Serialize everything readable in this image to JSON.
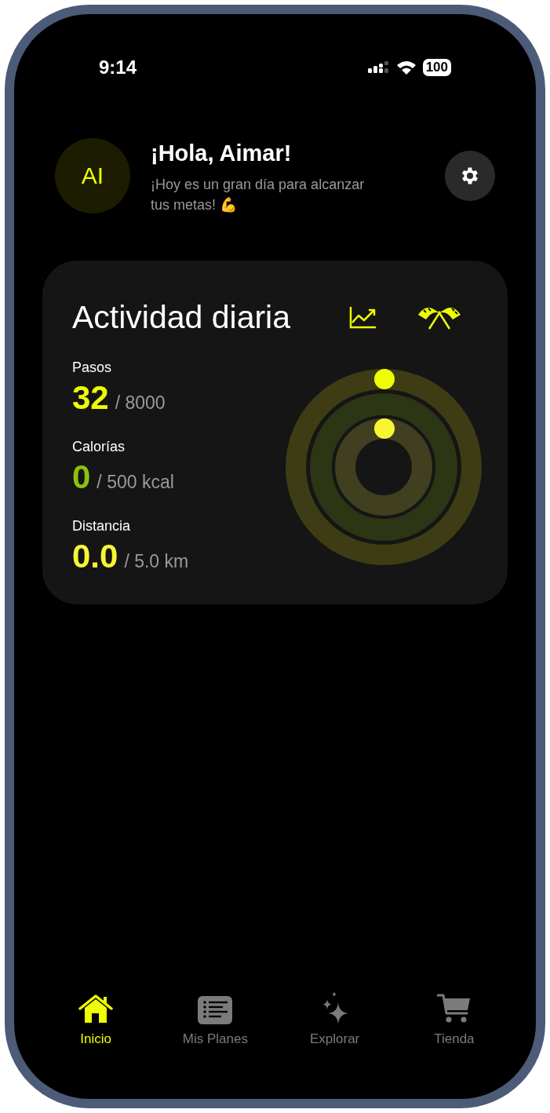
{
  "status_bar": {
    "time": "9:14",
    "battery": "100"
  },
  "header": {
    "avatar": "AI",
    "title": "¡Hola, Aimar!",
    "subtitle": "¡Hoy es un gran día para alcanzar tus metas! 💪"
  },
  "activity": {
    "title": "Actividad diaria",
    "metrics": [
      {
        "label": "Pasos",
        "value": "32",
        "goal": "/ 8000",
        "color": "#eeff00"
      },
      {
        "label": "Calorías",
        "value": "0",
        "goal": "/ 500 kcal",
        "color": "#8fc10a"
      },
      {
        "label": "Distancia",
        "value": "0.0",
        "goal": "/ 5.0 km",
        "color": "#f8f532"
      }
    ]
  },
  "tabs": [
    {
      "label": "Inicio",
      "kind": "home",
      "selected": true
    },
    {
      "label": "Mis Planes",
      "kind": "list",
      "selected": false
    },
    {
      "label": "Explorar",
      "kind": "sparkle",
      "selected": false
    },
    {
      "label": "Tienda",
      "kind": "cart",
      "selected": false
    }
  ]
}
